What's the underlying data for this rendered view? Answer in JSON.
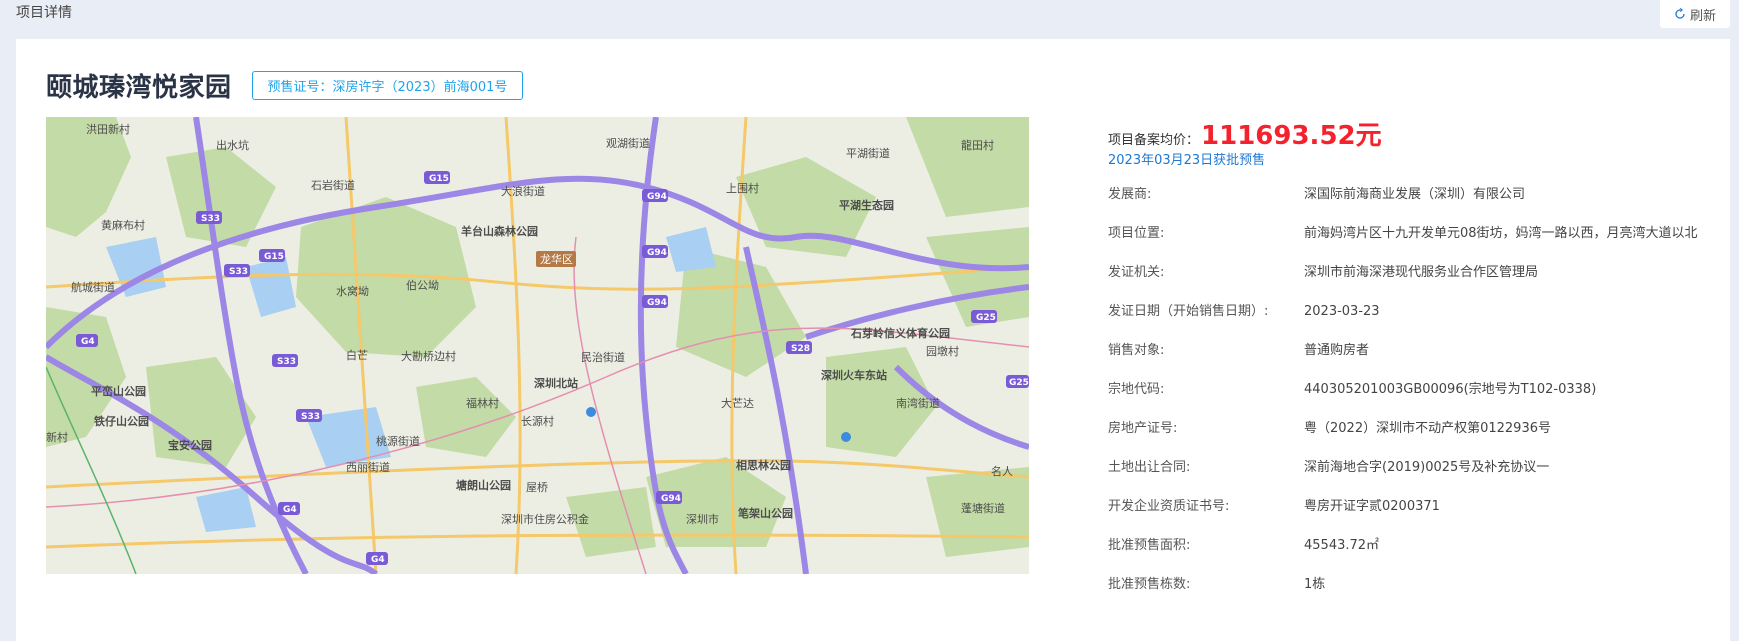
{
  "header": {
    "page_label": "项目详情",
    "refresh_label": "刷新"
  },
  "project": {
    "title": "颐城瑧湾悦家园",
    "permit_badge": "预售证号：深房许字（2023）前海001号"
  },
  "price": {
    "label": "项目备案均价：",
    "value": "111693.52元",
    "approval_note": "2023年03月23日获批预售"
  },
  "fields": [
    {
      "label": "发展商:",
      "value": "深国际前海商业发展（深圳）有限公司"
    },
    {
      "label": "项目位置:",
      "value": "前海妈湾片区十九开发单元08街坊，妈湾一路以西，月亮湾大道以北"
    },
    {
      "label": "发证机关:",
      "value": "深圳市前海深港现代服务业合作区管理局"
    },
    {
      "label": "发证日期（开始销售日期）:",
      "value": "2023-03-23"
    },
    {
      "label": "销售对象:",
      "value": "普通购房者"
    },
    {
      "label": "宗地代码:",
      "value": "440305201003GB00096(宗地号为T102-0338)"
    },
    {
      "label": "房地产证号:",
      "value": "粤（2022）深圳市不动产权第0122936号"
    },
    {
      "label": "土地出让合同:",
      "value": "深前海地合字(2019)0025号及补充协议一"
    },
    {
      "label": "开发企业资质证书号:",
      "value": "粤房开证字贰0200371"
    },
    {
      "label": "批准预售面积:",
      "value": "45543.72㎡"
    },
    {
      "label": "批准预售栋数:",
      "value": "1栋"
    }
  ],
  "map": {
    "labels": {
      "l1": "洪田新村",
      "l2": "出水坑",
      "l3": "石岩街道",
      "l4": "大浪街道",
      "l5": "观湖街道",
      "l6": "平湖街道",
      "l7": "上围村",
      "l8": "平湖生态园",
      "l9": "黄麻布村",
      "l10": "羊台山森林公园",
      "l11": "龙华区",
      "l12": "航城街道",
      "l13": "水窝坳",
      "l14": "伯公坳",
      "l15": "石芽岭信义体育公园",
      "l16": "白芒",
      "l17": "大勘桥边村",
      "l18": "民治街道",
      "l19": "深圳北站",
      "l20": "平峦山公园",
      "l21": "铁仔山公园",
      "l22": "宝安公园",
      "l23": "福林村",
      "l24": "长源村",
      "l25": "深圳火车东站",
      "l26": "南湾街道",
      "l27": "大芒达",
      "l28": "桃源街道",
      "l29": "西丽街道",
      "l30": "塘朗山公园",
      "l31": "屋桥",
      "l32": "相思林公园",
      "l33": "深圳市住房公积金",
      "l34": "深圳市",
      "l35": "笔架山公园",
      "l36": "园墩村",
      "l37": "新村",
      "l38": "名人",
      "l39": "蓬塘街道",
      "l40": "龍田村"
    },
    "roads": {
      "g15a": "G15",
      "g15b": "G15",
      "s33a": "S33",
      "s33b": "S33",
      "s33c": "S33",
      "s33d": "S33",
      "g94a": "G94",
      "g94b": "G94",
      "g94c": "G94",
      "g94d": "G94",
      "g4a": "G4",
      "g4b": "G4",
      "g4c": "G4",
      "s28": "S28",
      "g25a": "G25",
      "g25b": "G25"
    }
  }
}
